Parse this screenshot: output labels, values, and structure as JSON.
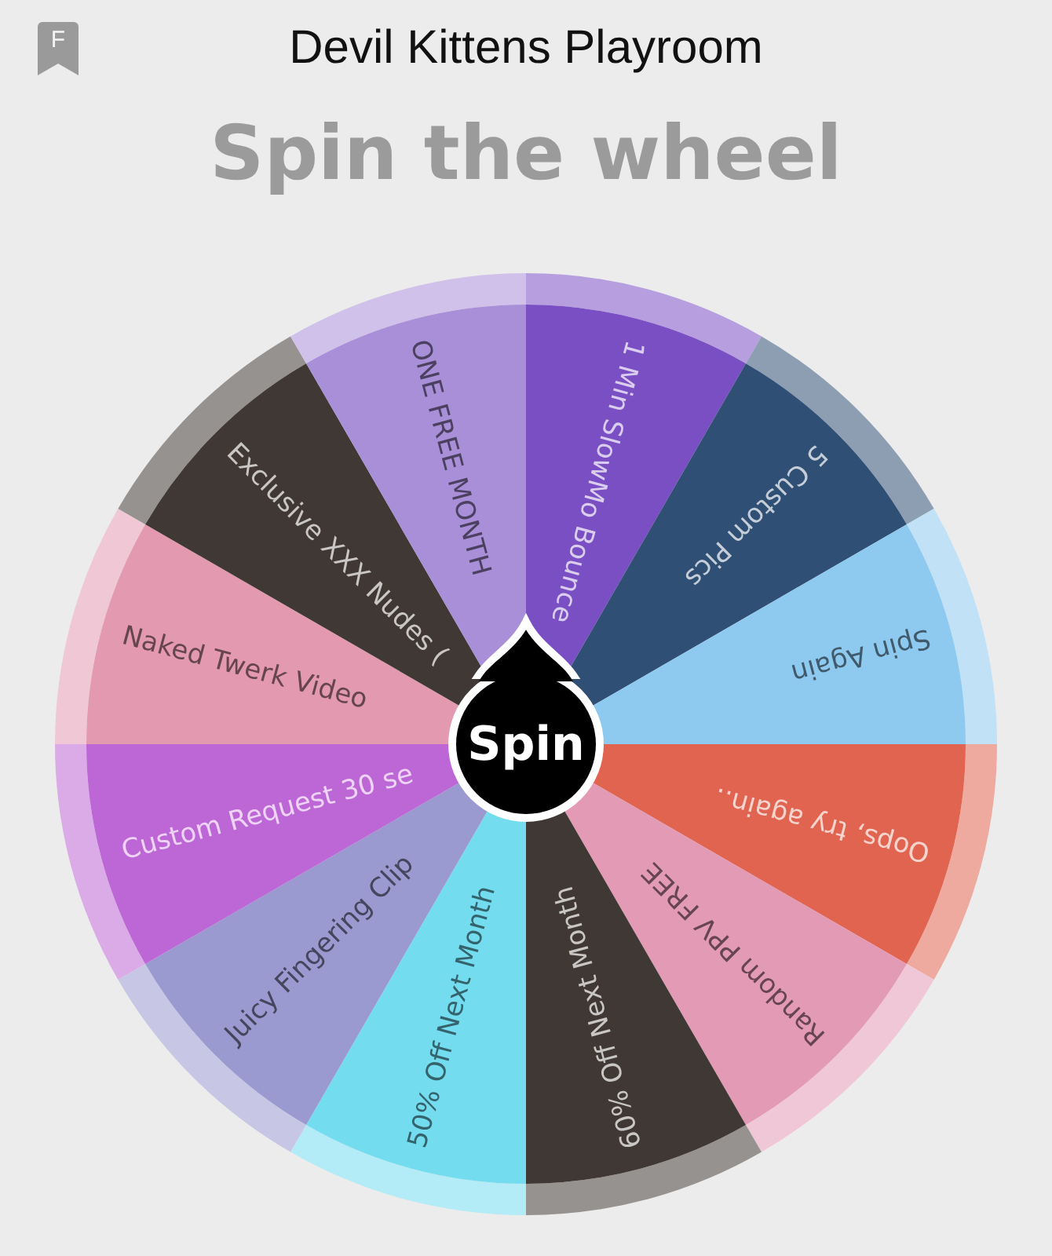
{
  "header": {
    "badge": "F",
    "title": "Devil Kittens Playroom"
  },
  "heading": "Spin the wheel",
  "wheel": {
    "button": "Spin",
    "segments": [
      {
        "label": "1 Min SlowMo Bounce",
        "color": "#7b4fc4"
      },
      {
        "label": "5 Custom Pics",
        "color": "#2f4f74"
      },
      {
        "label": "Spin Again",
        "color": "#8ec9ef"
      },
      {
        "label": "Oops, try again..",
        "color": "#e06450"
      },
      {
        "label": "Random PPV FREE",
        "color": "#e39ab5"
      },
      {
        "label": "60% Off Next Month",
        "color": "#3f3834"
      },
      {
        "label": "50% Off Next Month",
        "color": "#74dcef"
      },
      {
        "label": "Juicy Fingering Clip",
        "color": "#9a9ad0"
      },
      {
        "label": "Custom Request 30 se",
        "color": "#bd66d6"
      },
      {
        "label": "Naked Twerk Video",
        "color": "#e39ab0"
      },
      {
        "label": "Exclusive XXX Nudes (",
        "color": "#3f3834"
      },
      {
        "label": "ONE FREE MONTH",
        "color": "#a98fd8"
      }
    ]
  }
}
